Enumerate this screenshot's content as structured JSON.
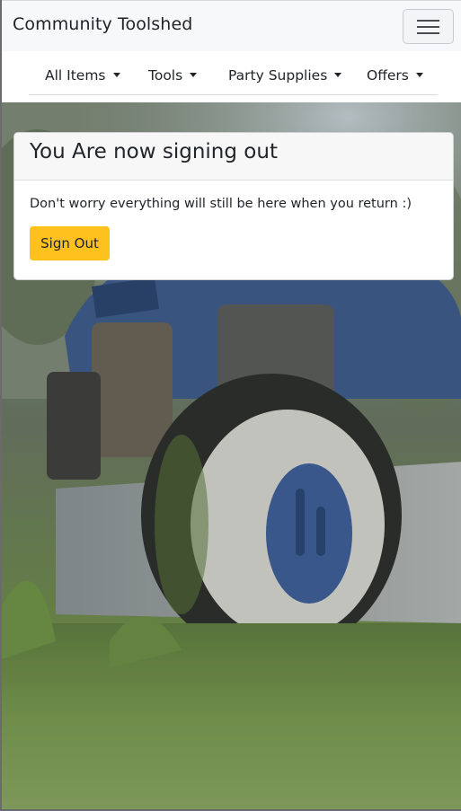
{
  "navbar": {
    "brand": "Community Toolshed",
    "toggler_icon": "hamburger-menu-icon"
  },
  "menu": {
    "items": [
      {
        "label": "All Items",
        "icon": "caret-down-icon"
      },
      {
        "label": "Tools",
        "icon": "caret-down-icon"
      },
      {
        "label": "Party Supplies",
        "icon": "caret-down-icon"
      },
      {
        "label": "Offers",
        "icon": "caret-down-icon"
      }
    ]
  },
  "card": {
    "title": "You Are now signing out",
    "text": "Don't worry everything will still be here when you return :)",
    "button_label": "Sign Out"
  },
  "colors": {
    "accent_button": "#ffc11e",
    "navbar_bg": "#f7f8f9"
  }
}
